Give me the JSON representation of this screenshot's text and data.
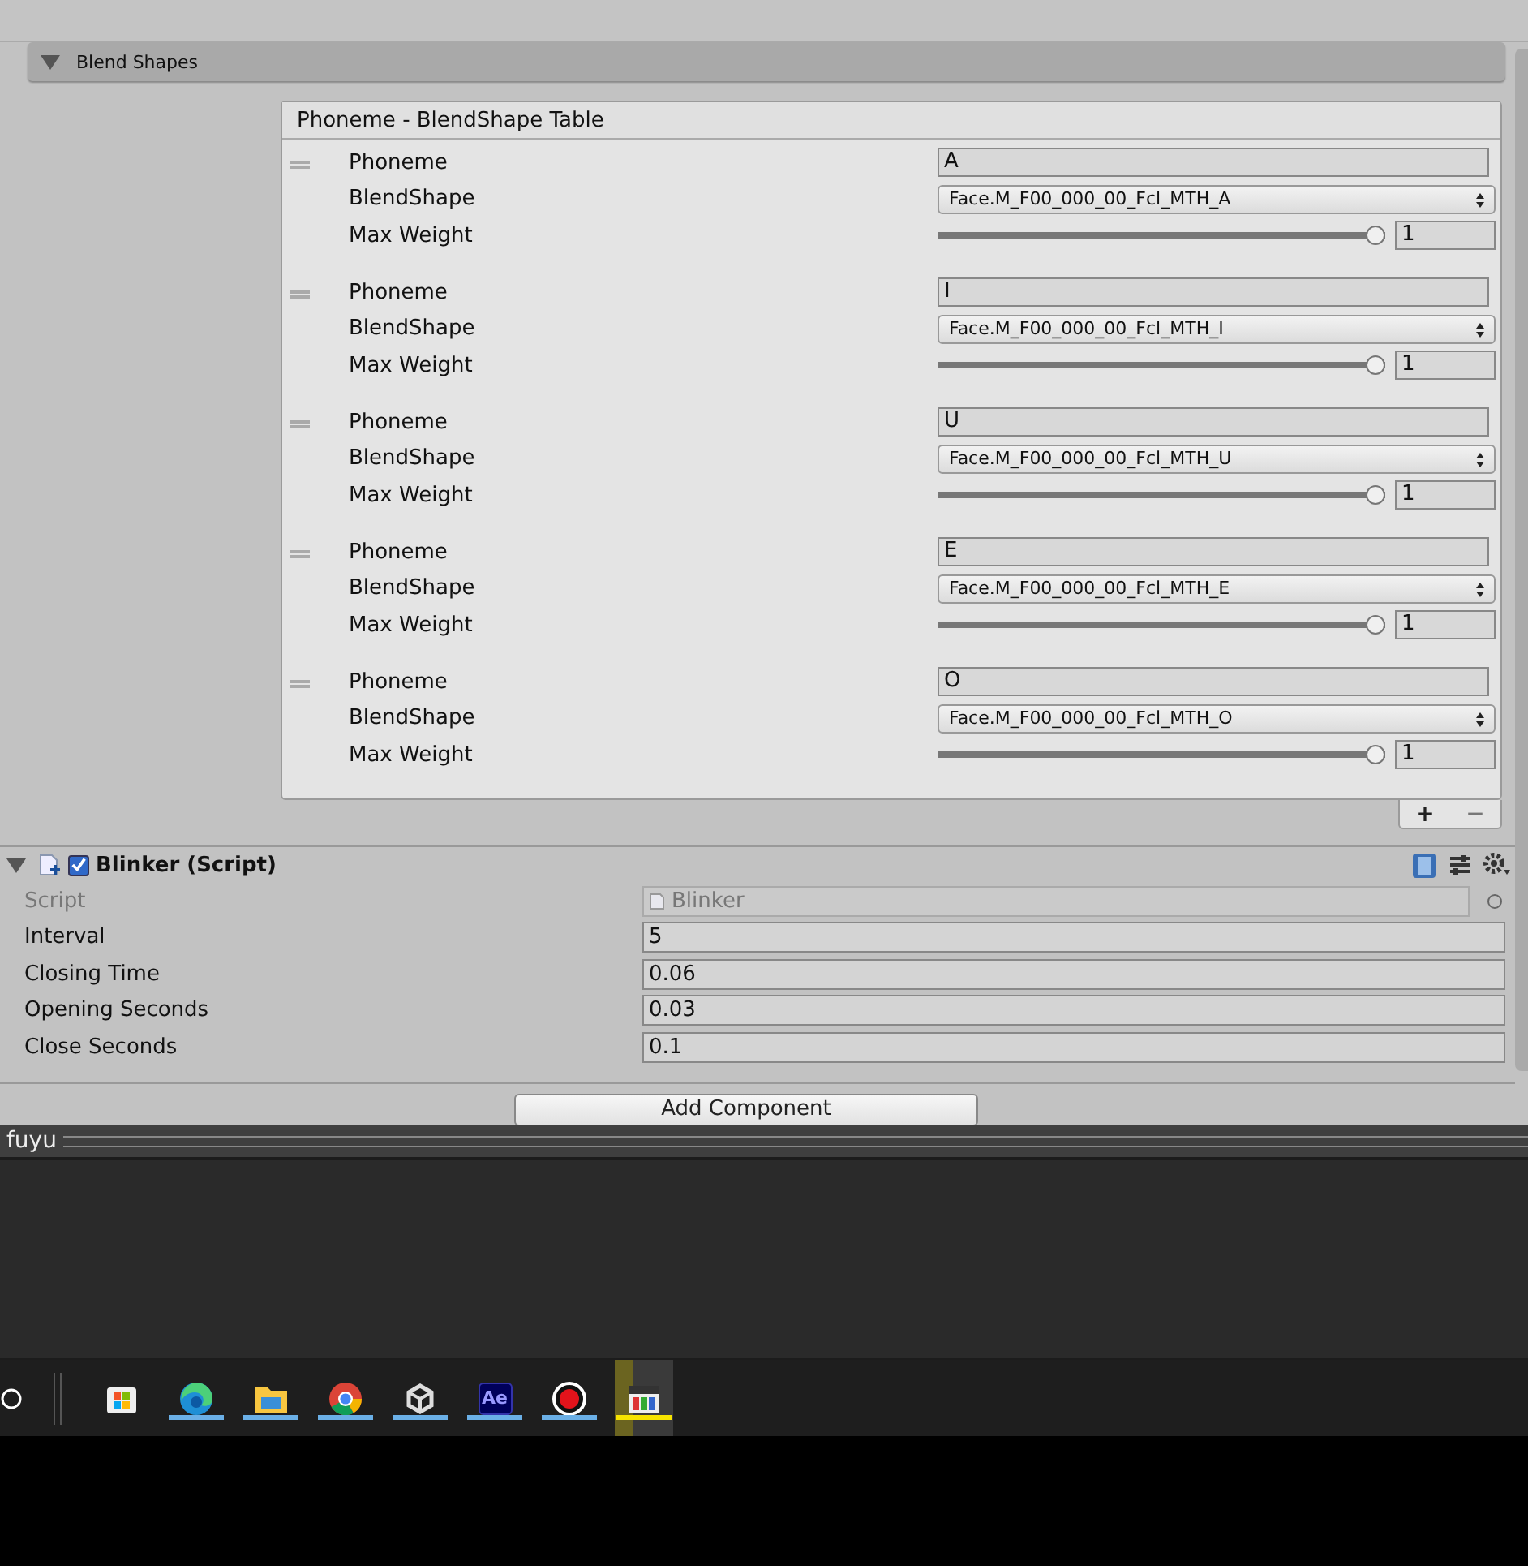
{
  "blend_shapes": {
    "title": "Blend Shapes",
    "expanded": true,
    "table": {
      "title": "Phoneme - BlendShape Table",
      "rows": [
        {
          "phoneme_label": "Phoneme",
          "phoneme": "A",
          "blendshape_label": "BlendShape",
          "blendshape": "Face.M_F00_000_00_Fcl_MTH_A",
          "weight_label": "Max Weight",
          "level": 1,
          "weight": "1"
        },
        {
          "phoneme_label": "Phoneme",
          "phoneme": "I",
          "blendshape_label": "BlendShape",
          "blendshape": "Face.M_F00_000_00_Fcl_MTH_I",
          "weight_label": "Max Weight",
          "level": 1,
          "weight": "1"
        },
        {
          "phoneme_label": "Phoneme",
          "phoneme": "U",
          "blendshape_label": "BlendShape",
          "blendshape": "Face.M_F00_000_00_Fcl_MTH_U",
          "weight_label": "Max Weight",
          "level": 1,
          "weight": "1"
        },
        {
          "phoneme_label": "Phoneme",
          "phoneme": "E",
          "blendshape_label": "BlendShape",
          "blendshape": "Face.M_F00_000_00_Fcl_MTH_E",
          "weight_label": "Max Weight",
          "level": 1,
          "weight": "1"
        },
        {
          "phoneme_label": "Phoneme",
          "phoneme": "O",
          "blendshape_label": "BlendShape",
          "blendshape": "Face.M_F00_000_00_Fcl_MTH_O",
          "weight_label": "Max Weight",
          "level": 1,
          "weight": "1"
        }
      ],
      "add": "+",
      "remove": "−"
    }
  },
  "component": {
    "title": "Blinker (Script)",
    "enabled": true,
    "expanded": true,
    "fields": [
      {
        "label": "Script",
        "value": "Blinker",
        "disabled": true
      },
      {
        "label": "Interval",
        "value": "5",
        "disabled": false
      },
      {
        "label": "Closing Time",
        "value": "0.06",
        "disabled": false
      },
      {
        "label": "Opening Seconds",
        "value": "0.03",
        "disabled": false
      },
      {
        "label": "Close Seconds",
        "value": "0.1",
        "disabled": false
      }
    ]
  },
  "add_component": "Add Component",
  "panel": {
    "title": "fuyu"
  },
  "taskbar": [
    {
      "kind": "store",
      "running": false,
      "active": false
    },
    {
      "kind": "edge",
      "running": true,
      "active": false
    },
    {
      "kind": "explorer",
      "running": true,
      "active": false
    },
    {
      "kind": "chrome",
      "running": true,
      "active": false
    },
    {
      "kind": "unity",
      "running": true,
      "active": false
    },
    {
      "kind": "ae",
      "label": "Ae",
      "running": true,
      "active": false
    },
    {
      "kind": "record",
      "running": true,
      "active": false
    },
    {
      "kind": "player",
      "running": true,
      "active": true
    }
  ]
}
